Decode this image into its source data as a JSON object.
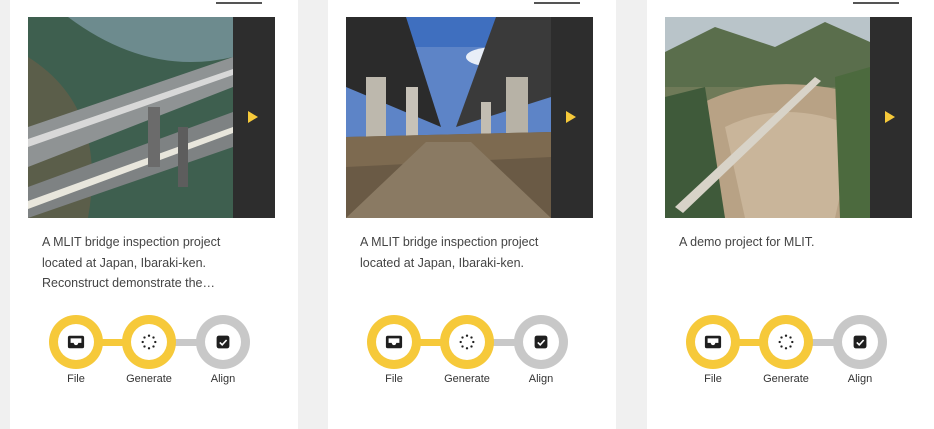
{
  "colors": {
    "accent": "#f6c93a",
    "inactive": "#c8c8c8",
    "icon": "#1f1f1f",
    "panel": "#2d2d2d"
  },
  "projects": [
    {
      "description": "A MLIT bridge inspection project located at Japan, Ibaraki-ken. Reconstruct demonstrate the…",
      "steps": [
        {
          "label": "File",
          "icon": "inbox-icon",
          "state": "done"
        },
        {
          "label": "Generate",
          "icon": "spinner-icon",
          "state": "done"
        },
        {
          "label": "Align",
          "icon": "checkbox-icon",
          "state": "pending"
        }
      ]
    },
    {
      "description": "A MLIT bridge inspection project located at Japan, Ibaraki-ken.",
      "steps": [
        {
          "label": "File",
          "icon": "inbox-icon",
          "state": "done"
        },
        {
          "label": "Generate",
          "icon": "spinner-icon",
          "state": "done"
        },
        {
          "label": "Align",
          "icon": "checkbox-icon",
          "state": "pending"
        }
      ]
    },
    {
      "description": "A demo project for MLIT.",
      "steps": [
        {
          "label": "File",
          "icon": "inbox-icon",
          "state": "done"
        },
        {
          "label": "Generate",
          "icon": "spinner-icon",
          "state": "done"
        },
        {
          "label": "Align",
          "icon": "checkbox-icon",
          "state": "pending"
        }
      ]
    }
  ]
}
